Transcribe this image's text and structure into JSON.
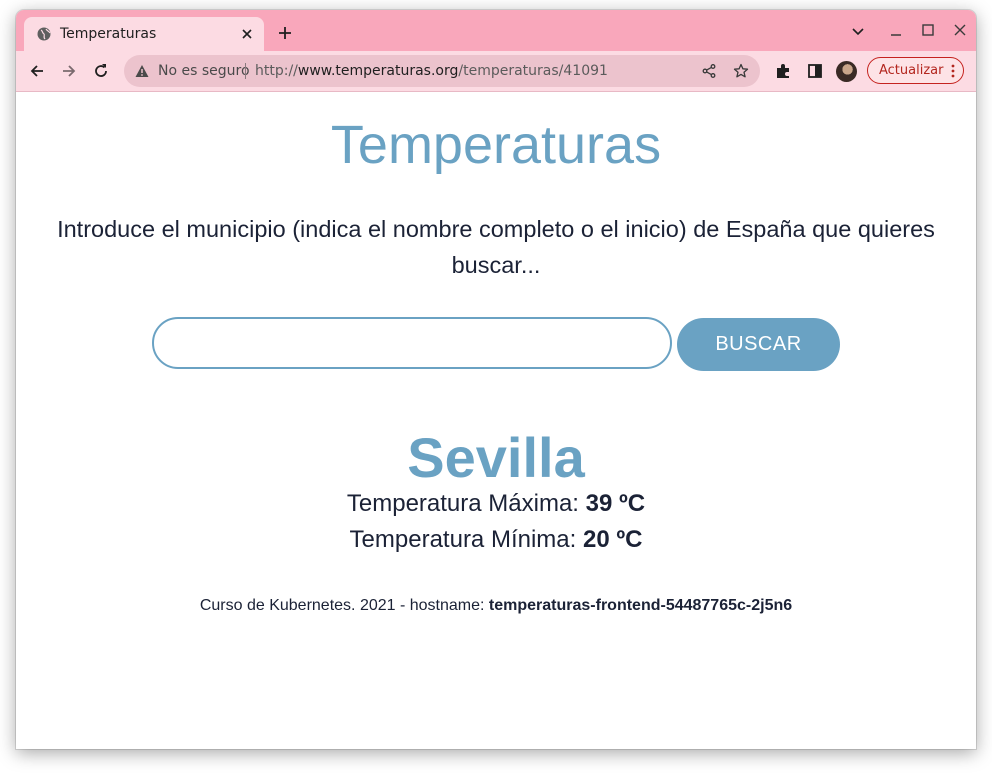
{
  "browser": {
    "tab_title": "Temperaturas",
    "security_label": "No es seguro",
    "url_prefix": "http://",
    "url_host": "www.temperaturas.org",
    "url_path": "/temperaturas/41091",
    "update_label": "Actualizar",
    "icons": [
      "globe-icon",
      "close-icon",
      "plus-icon",
      "chevron-down-icon",
      "minimize-icon",
      "maximize-icon",
      "back-icon",
      "forward-icon",
      "reload-icon",
      "warning-icon",
      "share-icon",
      "star-icon",
      "extensions-icon",
      "side-panel-icon",
      "more-vert-icon"
    ],
    "colors": {
      "tabstrip": "#f9a7bb",
      "toolbar": "#fcdbe3",
      "update_border": "#c5221f"
    }
  },
  "page": {
    "title": "Temperaturas",
    "intro": "Introduce el municipio (indica el nombre completo o el inicio) de España que quieres buscar...",
    "search": {
      "value": "",
      "placeholder": ""
    },
    "search_button": "BUSCAR",
    "city": "Sevilla",
    "max_label": "Temperatura Máxima: ",
    "max_value": "39 ºC",
    "min_label": "Temperatura Mínima: ",
    "min_value": "20 ºC",
    "footer_text": "Curso de Kubernetes. 2021 - hostname: ",
    "hostname": "temperaturas-frontend-54487765c-2j5n6",
    "colors": {
      "accent": "#6aa2c3",
      "text": "#1b2236"
    }
  }
}
